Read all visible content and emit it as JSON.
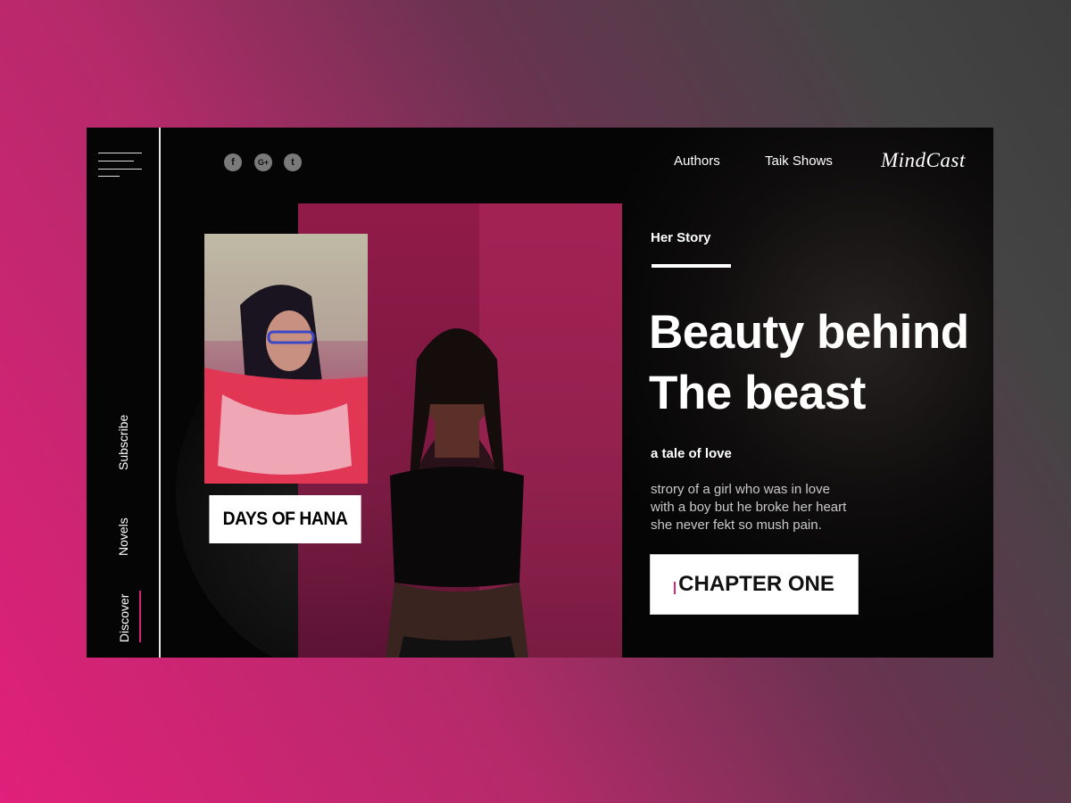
{
  "brand": "MindCast",
  "nav": {
    "authors": "Authors",
    "talk_shows": "Taik Shows"
  },
  "social": [
    {
      "icon": "facebook-icon",
      "glyph": "f"
    },
    {
      "icon": "google-plus-icon",
      "glyph": "G+"
    },
    {
      "icon": "twitter-icon",
      "glyph": "t"
    }
  ],
  "sidebar": {
    "subscribe": "Subscribe",
    "novels": "Novels",
    "discover": "Discover"
  },
  "card": {
    "title": "DAYS OF HANA"
  },
  "story": {
    "kicker": "Her Story",
    "headline_line1": "Beauty behind",
    "headline_line2": "The beast",
    "tagline": "a tale of love",
    "description_lines": [
      "strory of a girl who was in love",
      "with a boy but he  broke her heart",
      "she never fekt so mush pain."
    ],
    "cta": "CHAPTER ONE"
  },
  "colors": {
    "accent": "#d3287a",
    "background_start": "#e0207a",
    "background_end": "#3d3d3d"
  }
}
